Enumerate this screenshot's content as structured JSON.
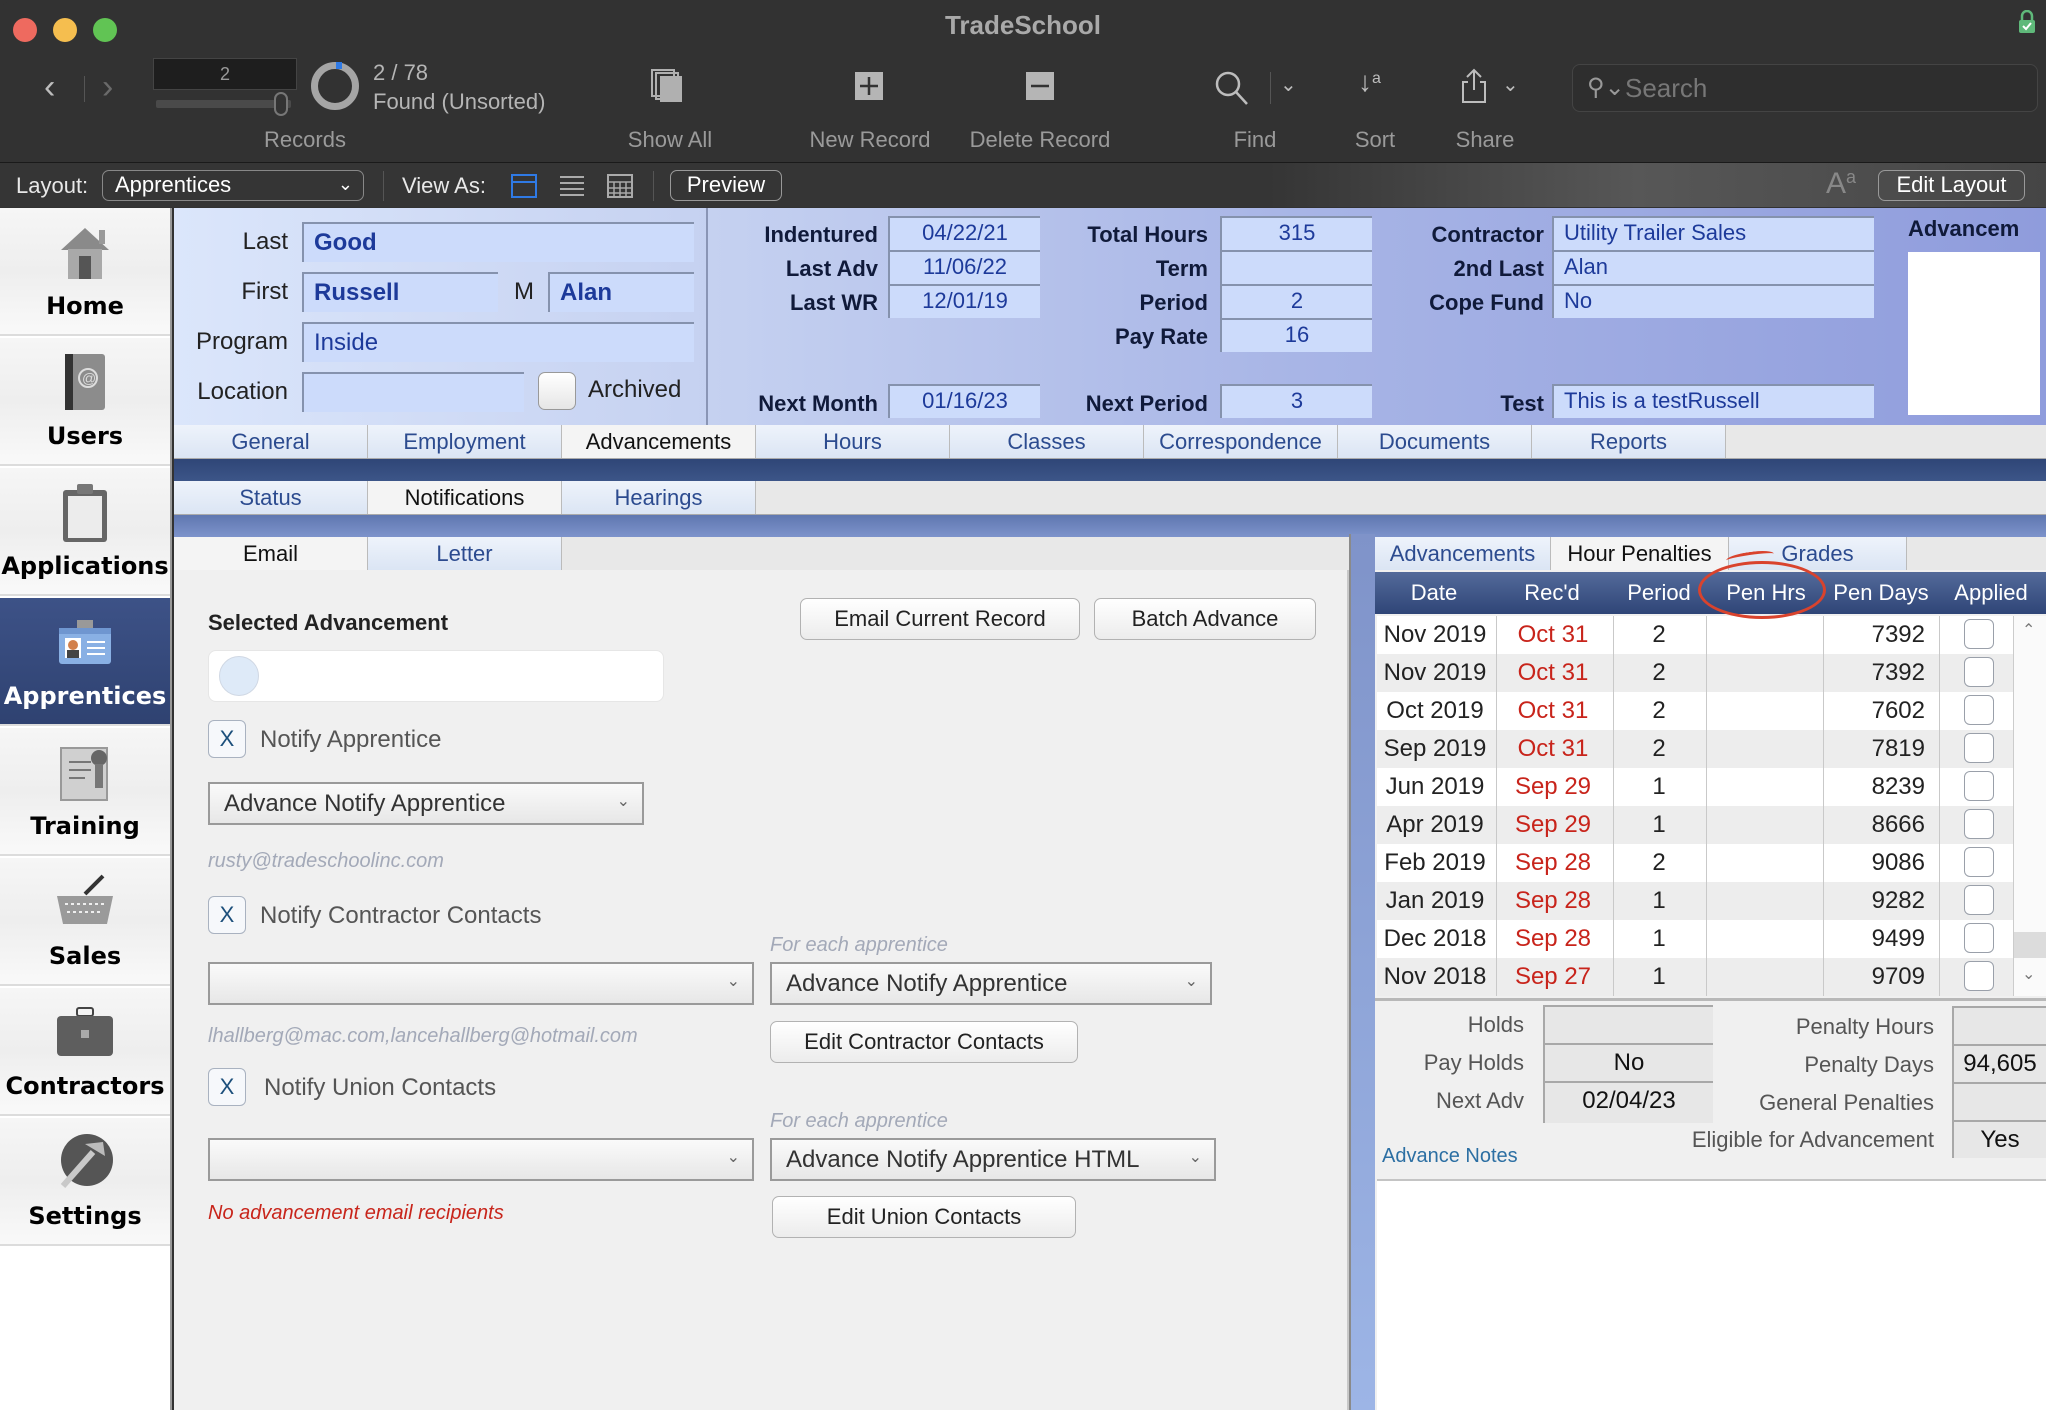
{
  "window": {
    "title": "TradeSchool"
  },
  "toolbar": {
    "record_current": "2",
    "records_label": "Records",
    "found_count": "2 / 78",
    "found_status": "Found (Unsorted)",
    "record_progress_fraction": 0.026,
    "show_all": "Show All",
    "new_record": "New Record",
    "delete_record": "Delete Record",
    "find": "Find",
    "sort": "Sort",
    "share": "Share",
    "search_placeholder": "Search"
  },
  "layout_bar": {
    "layout_label": "Layout:",
    "layout_value": "Apprentices",
    "view_as_label": "View As:",
    "preview": "Preview",
    "edit_layout": "Edit Layout",
    "font_icon": "Aa"
  },
  "sidebar": {
    "items": [
      {
        "label": "Home",
        "icon": "house-icon"
      },
      {
        "label": "Users",
        "icon": "address-book-icon"
      },
      {
        "label": "Applications",
        "icon": "clipboard-icon"
      },
      {
        "label": "Apprentices",
        "icon": "id-badge-icon",
        "active": true
      },
      {
        "label": "Training",
        "icon": "certificate-icon"
      },
      {
        "label": "Sales",
        "icon": "basket-icon"
      },
      {
        "label": "Contractors",
        "icon": "briefcase-icon"
      },
      {
        "label": "Settings",
        "icon": "hammer-globe-icon"
      }
    ]
  },
  "header": {
    "last_label": "Last",
    "last": "Good",
    "first_label": "First",
    "first": "Russell",
    "middle_label": "M",
    "middle": "Alan",
    "program_label": "Program",
    "program": "Inside",
    "location_label": "Location",
    "location": "",
    "archived_label": "Archived",
    "indentured_label": "Indentured",
    "indentured": "04/22/21",
    "last_adv_label": "Last Adv",
    "last_adv": "11/06/22",
    "last_wr_label": "Last WR",
    "last_wr": "12/01/19",
    "next_month_label": "Next Month",
    "next_month": "01/16/23",
    "total_hours_label": "Total Hours",
    "total_hours": "315",
    "term_label": "Term",
    "term": "",
    "period_label": "Period",
    "period": "2",
    "pay_rate_label": "Pay Rate",
    "pay_rate": "16",
    "next_period_label": "Next Period",
    "next_period": "3",
    "contractor_label": "Contractor",
    "contractor": "Utility Trailer Sales",
    "second_last_label": "2nd Last",
    "second_last": "Alan",
    "cope_fund_label": "Cope Fund",
    "cope_fund": "No",
    "test_label": "Test",
    "test": "This is a testRussell",
    "advancement_label": "Advancem"
  },
  "tabs": {
    "main": [
      "General",
      "Employment",
      "Advancements",
      "Hours",
      "Classes",
      "Correspondence",
      "Documents",
      "Reports"
    ],
    "main_selected": "Advancements",
    "sub": [
      "Status",
      "Notifications",
      "Hearings"
    ],
    "sub_selected": "Notifications",
    "left": [
      "Email",
      "Letter"
    ],
    "left_selected": "Email",
    "right": [
      "Advancements",
      "Hour Penalties",
      "Grades"
    ],
    "right_selected": "Hour Penalties"
  },
  "email_panel": {
    "selected_advancement_label": "Selected Advancement",
    "email_current_record": "Email Current Record",
    "batch_advance": "Batch Advance",
    "notify_apprentice_checked": "X",
    "notify_apprentice_label": "Notify Apprentice",
    "apprentice_template": "Advance Notify Apprentice",
    "apprentice_email": "rusty@tradeschoolinc.com",
    "notify_contractor_checked": "X",
    "notify_contractor_label": "Notify Contractor Contacts",
    "contractor_contact_select": "",
    "for_each_apprentice_1": "For each apprentice",
    "contractor_template": "Advance Notify Apprentice",
    "contractor_emails": "lhallberg@mac.com,lancehallberg@hotmail.com",
    "edit_contractor_contacts": "Edit Contractor Contacts",
    "notify_union_checked": "X",
    "notify_union_label": "Notify Union Contacts",
    "union_contact_select": "",
    "for_each_apprentice_2": "For each apprentice",
    "union_template": "Advance Notify Apprentice HTML",
    "no_recipients": "No advancement email recipients",
    "edit_union_contacts": "Edit Union Contacts"
  },
  "penalties_table": {
    "columns": [
      "Date",
      "Rec'd",
      "Period",
      "Pen Hrs",
      "Pen Days",
      "Applied"
    ],
    "rows": [
      {
        "date": "Nov 2019",
        "recd": "Oct 31",
        "period": "2",
        "pen_hrs": "",
        "pen_days": "7392",
        "applied": false
      },
      {
        "date": "Nov 2019",
        "recd": "Oct 31",
        "period": "2",
        "pen_hrs": "",
        "pen_days": "7392",
        "applied": false
      },
      {
        "date": "Oct 2019",
        "recd": "Oct 31",
        "period": "2",
        "pen_hrs": "",
        "pen_days": "7602",
        "applied": false
      },
      {
        "date": "Sep 2019",
        "recd": "Oct 31",
        "period": "2",
        "pen_hrs": "",
        "pen_days": "7819",
        "applied": false
      },
      {
        "date": "Jun 2019",
        "recd": "Sep 29",
        "period": "1",
        "pen_hrs": "",
        "pen_days": "8239",
        "applied": false
      },
      {
        "date": "Apr 2019",
        "recd": "Sep 29",
        "period": "1",
        "pen_hrs": "",
        "pen_days": "8666",
        "applied": false
      },
      {
        "date": "Feb 2019",
        "recd": "Sep 28",
        "period": "2",
        "pen_hrs": "",
        "pen_days": "9086",
        "applied": false
      },
      {
        "date": "Jan 2019",
        "recd": "Sep 28",
        "period": "1",
        "pen_hrs": "",
        "pen_days": "9282",
        "applied": false
      },
      {
        "date": "Dec 2018",
        "recd": "Sep 28",
        "period": "1",
        "pen_hrs": "",
        "pen_days": "9499",
        "applied": false
      },
      {
        "date": "Nov 2018",
        "recd": "Sep 27",
        "period": "1",
        "pen_hrs": "",
        "pen_days": "9709",
        "applied": false
      }
    ]
  },
  "summary": {
    "holds_label": "Holds",
    "holds": "",
    "pay_holds_label": "Pay Holds",
    "pay_holds": "No",
    "next_adv_label": "Next Adv",
    "next_adv": "02/04/23",
    "penalty_hours_label": "Penalty Hours",
    "penalty_hours": "",
    "penalty_days_label": "Penalty Days",
    "penalty_days": "94,605",
    "general_penalties_label": "General Penalties",
    "general_penalties": "",
    "eligible_label": "Eligible for Advancement",
    "eligible": "Yes",
    "advance_notes_label": "Advance Notes",
    "advance_notes": ""
  },
  "colors": {
    "accent_blue": "#2f7ae5",
    "header_text": "#1d3a9a",
    "recd_red": "#c8241b",
    "annotation_red": "#d9432d",
    "sidebar_active": "#35497b"
  }
}
